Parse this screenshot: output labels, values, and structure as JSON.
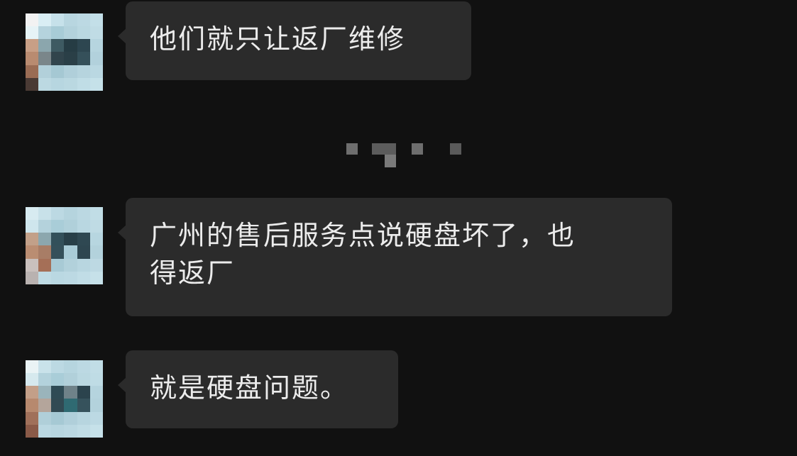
{
  "messages": [
    {
      "text": "他们就只让返厂维修"
    },
    {
      "text": "广州的售后服务点说硬盘坏了，也\n得返厂"
    },
    {
      "text": "就是硬盘问题。"
    }
  ]
}
